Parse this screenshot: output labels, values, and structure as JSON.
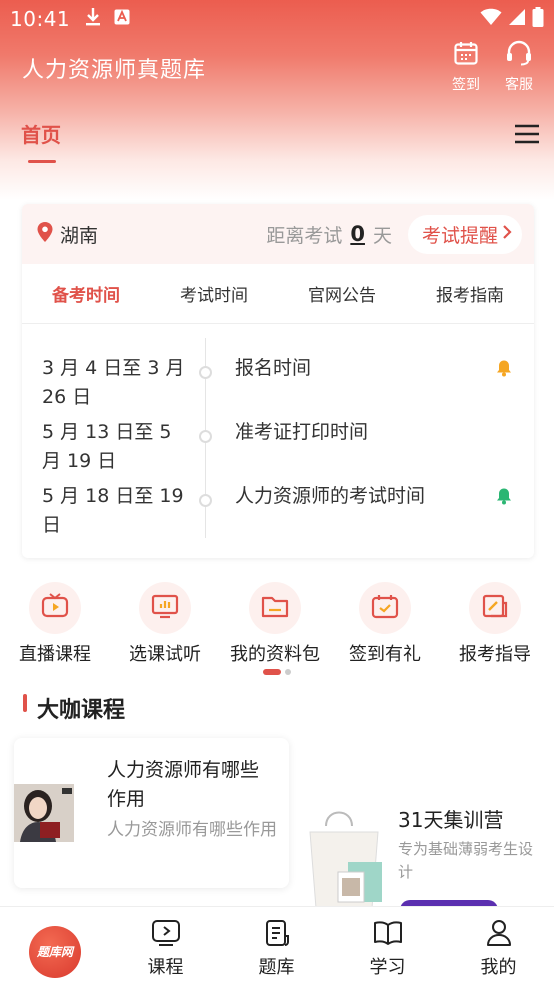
{
  "status_bar": {
    "time": "10:41"
  },
  "header": {
    "title": "人力资源师真题库",
    "checkin_label": "签到",
    "service_label": "客服"
  },
  "nav": {
    "home_label": "首页"
  },
  "exam_card": {
    "location": "湖南",
    "countdown_prefix": "距离考试",
    "countdown_days": "0",
    "countdown_unit": "天",
    "remind_label": "考试提醒",
    "tabs": [
      {
        "label": "备考时间"
      },
      {
        "label": "考试时间"
      },
      {
        "label": "官网公告"
      },
      {
        "label": "报考指南"
      }
    ],
    "timeline": [
      {
        "date": "3 月 4 日至 3 月 26 日",
        "event": "报名时间",
        "bell": "orange"
      },
      {
        "date": "5 月 13 日至 5 月 19 日",
        "event": "准考证打印时间",
        "bell": ""
      },
      {
        "date": "5 月 18 日至 19 日",
        "event": "人力资源师的考试时间",
        "bell": "green"
      }
    ]
  },
  "quick_links": [
    {
      "label": "直播课程",
      "icon": "tv-play-icon"
    },
    {
      "label": "选课试听",
      "icon": "chart-screen-icon"
    },
    {
      "label": "我的资料包",
      "icon": "folder-icon"
    },
    {
      "label": "签到有礼",
      "icon": "calendar-check-icon"
    },
    {
      "label": "报考指导",
      "icon": "edit-doc-icon"
    }
  ],
  "section": {
    "title": "大咖课程"
  },
  "course": {
    "title": "人力资源师有哪些作用",
    "subtitle": "人力资源师有哪些作用"
  },
  "promo": {
    "title": "31天集训营",
    "subtitle": "专为基础薄弱考生设计"
  },
  "bottom_nav": {
    "logo_text": "题库网",
    "items": [
      {
        "label": "课程"
      },
      {
        "label": "题库"
      },
      {
        "label": "学习"
      },
      {
        "label": "我的"
      }
    ]
  },
  "colors": {
    "accent": "#e0524a",
    "bell_orange": "#f5a623",
    "bell_green": "#2bb673"
  }
}
